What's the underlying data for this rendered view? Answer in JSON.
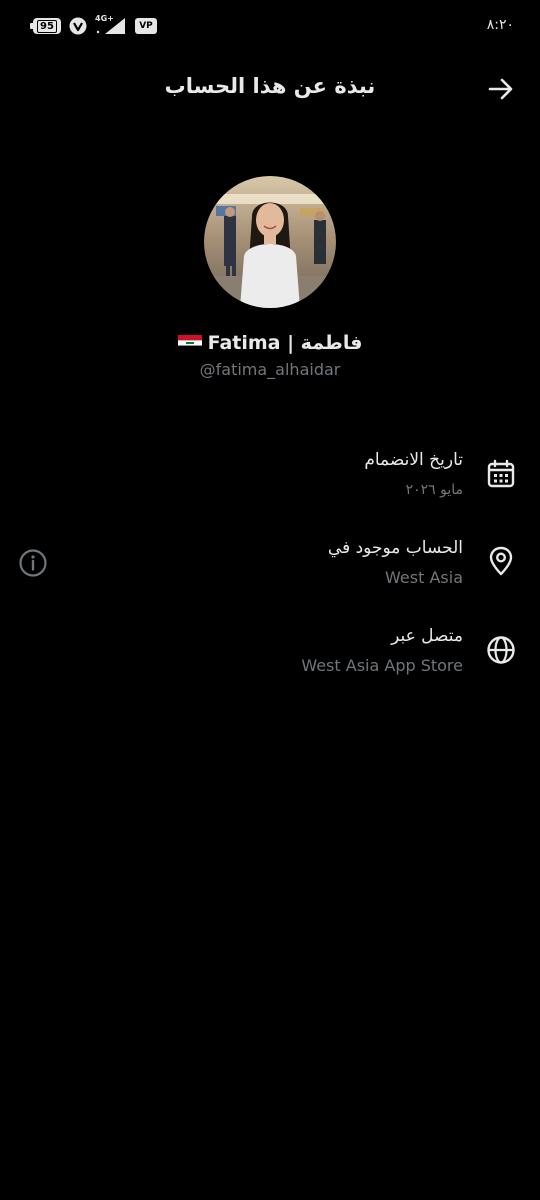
{
  "status_bar": {
    "battery_level": "95",
    "network_label": "4G+",
    "vpn_label": "VP",
    "time": "٨:٢٠"
  },
  "header": {
    "title": "نبذة عن هذا الحساب",
    "back_icon": "arrow-right-icon"
  },
  "profile": {
    "avatar_icon": "profile-avatar-photo",
    "name": "فاطمة | Fatima",
    "flag_icon": "iraq-flag-icon",
    "handle": "@fatima_alhaidar"
  },
  "info": {
    "joined": {
      "icon": "calendar-icon",
      "label": "تاريخ الانضمام",
      "value": "مايو ٢٠٢٦"
    },
    "location": {
      "icon": "location-pin-icon",
      "label": "الحساب موجود في",
      "value": "West Asia"
    },
    "connected": {
      "icon": "globe-icon",
      "label": "متصل عبر",
      "value": "West Asia App Store"
    },
    "about_icon": "info-circle-icon"
  },
  "colors": {
    "background": "#000000",
    "primary_text": "#e7e9ea",
    "secondary_text": "#71767b"
  }
}
